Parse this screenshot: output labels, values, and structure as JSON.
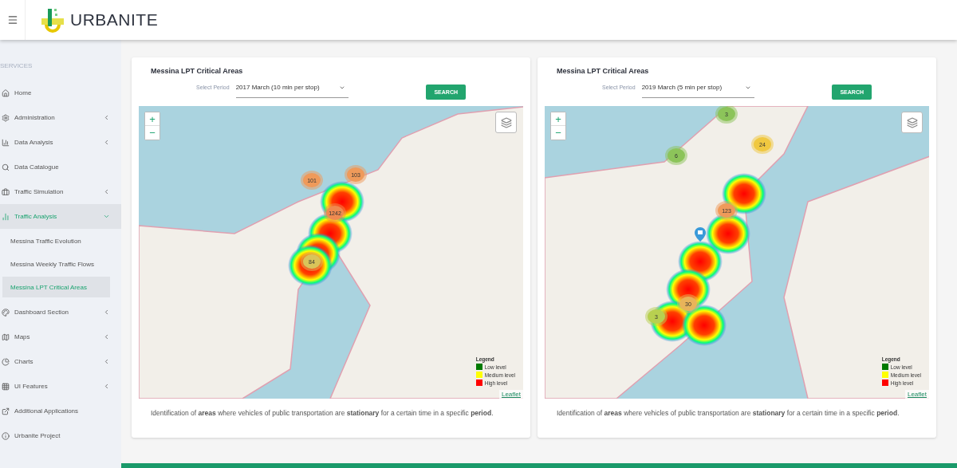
{
  "header": {
    "brand": "URBANITE"
  },
  "sidebar": {
    "heading": "SERVICES",
    "items": [
      {
        "label": "Home",
        "kind": "link",
        "selected": false
      },
      {
        "label": "Administration",
        "kind": "group",
        "expanded": false,
        "selected": false
      },
      {
        "label": "Data Analysis",
        "kind": "group",
        "expanded": false,
        "selected": false
      },
      {
        "label": "Data Catalogue",
        "kind": "link",
        "selected": false
      },
      {
        "label": "Traffic Simulation",
        "kind": "group",
        "expanded": false,
        "selected": false
      },
      {
        "label": "Traffic Analysis",
        "kind": "group",
        "expanded": true,
        "selected": true,
        "children": [
          {
            "label": "Messina Traffic Evolution",
            "selected": false
          },
          {
            "label": "Messina Weekly Traffic Flows",
            "selected": false
          },
          {
            "label": "Messina LPT Critical Areas",
            "selected": true
          }
        ]
      },
      {
        "label": "Dashboard Section",
        "kind": "group",
        "expanded": false,
        "selected": false
      },
      {
        "label": "Maps",
        "kind": "group",
        "expanded": false,
        "selected": false
      },
      {
        "label": "Charts",
        "kind": "group",
        "expanded": false,
        "selected": false
      },
      {
        "label": "UI Features",
        "kind": "group",
        "expanded": false,
        "selected": false
      },
      {
        "label": "Additional Applications",
        "kind": "link",
        "selected": false
      },
      {
        "label": "Urbanite Project",
        "kind": "link",
        "selected": false
      }
    ]
  },
  "cards": [
    {
      "title": "Messina LPT Critical Areas",
      "period_label": "Select Period",
      "period": "2017 March (10 min per stop)",
      "button": "SEARCH",
      "zoom_in": "+",
      "zoom_out": "−",
      "clusters": [
        {
          "count": "101",
          "color": "#ef9a5a"
        },
        {
          "count": "103",
          "color": "#ef9a5a"
        },
        {
          "count": "1242",
          "color": "#ef8a50"
        },
        {
          "count": "84",
          "color": "#d9c45a"
        }
      ],
      "pin": false,
      "legend": {
        "title": "Legend",
        "items": [
          {
            "label": "Low level",
            "color": "#007a00"
          },
          {
            "label": "Medium level",
            "color": "#ffff00"
          },
          {
            "label": "High level",
            "color": "#ff0000"
          }
        ]
      },
      "attribution": "Leaflet",
      "description": "Identification of **areas** where vehicles of public transportation are **stationary** for a certain time in a specific **period**."
    },
    {
      "title": "Messina LPT Critical Areas",
      "period_label": "Select Period",
      "period": "2019 March (5 min per stop)",
      "button": "SEARCH",
      "zoom_in": "+",
      "zoom_out": "−",
      "clusters": [
        {
          "count": "3",
          "color": "#8cc45a"
        },
        {
          "count": "6",
          "color": "#8cc45a"
        },
        {
          "count": "24",
          "color": "#f0c840"
        },
        {
          "count": "123",
          "color": "#ef9a5a"
        },
        {
          "count": "30",
          "color": "#e8b45a"
        },
        {
          "count": "3",
          "color": "#b8d050"
        }
      ],
      "pin": true,
      "legend": {
        "title": "Legend",
        "items": [
          {
            "label": "Low level",
            "color": "#007a00"
          },
          {
            "label": "Medium level",
            "color": "#ffff00"
          },
          {
            "label": "High level",
            "color": "#ff0000"
          }
        ]
      },
      "attribution": "Leaflet",
      "description": "Identification of **areas** where vehicles of public transportation are **stationary** for a certain time in a specific **period**."
    }
  ]
}
